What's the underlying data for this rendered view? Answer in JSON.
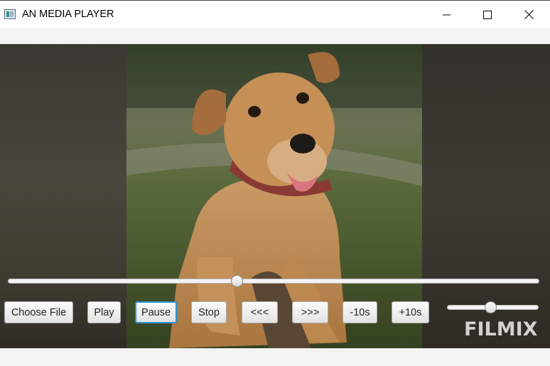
{
  "window": {
    "title": "AN MEDIA PLAYER",
    "controls": [
      "minimize-icon",
      "maximize-icon",
      "close-icon"
    ]
  },
  "video": {
    "watermark": "FILMIX",
    "seek_progress": 0.43,
    "volume_level": 0.47
  },
  "controls": {
    "choose_file": "Choose File",
    "play": "Play",
    "pause": "Pause",
    "stop": "Stop",
    "rewind": "<<<",
    "forward": ">>>",
    "back10": "-10s",
    "fwd10": "+10s"
  },
  "colors": {
    "focus_border": "#2a96d3",
    "title_bar": "#ffffff",
    "background": "#f0f0f0"
  }
}
